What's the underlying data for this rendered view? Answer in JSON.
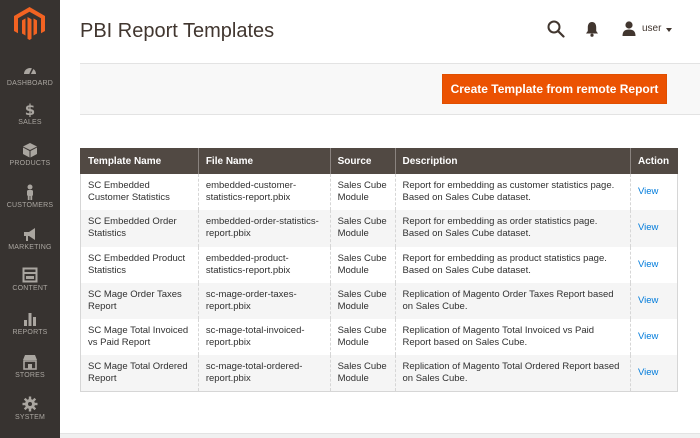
{
  "sidebar": {
    "items": [
      {
        "label": "DASHBOARD",
        "icon": "dashboard-icon"
      },
      {
        "label": "SALES",
        "icon": "dollar-icon"
      },
      {
        "label": "PRODUCTS",
        "icon": "box-icon"
      },
      {
        "label": "CUSTOMERS",
        "icon": "person-icon"
      },
      {
        "label": "MARKETING",
        "icon": "megaphone-icon"
      },
      {
        "label": "CONTENT",
        "icon": "layout-icon"
      },
      {
        "label": "REPORTS",
        "icon": "bar-chart-icon"
      },
      {
        "label": "STORES",
        "icon": "storefront-icon"
      },
      {
        "label": "SYSTEM",
        "icon": "gear-icon"
      }
    ]
  },
  "header": {
    "title": "PBI Report Templates",
    "user": "user"
  },
  "actions": {
    "create_label": "Create Template from remote Report"
  },
  "table": {
    "columns": [
      "Template Name",
      "File Name",
      "Source",
      "Description",
      "Action"
    ],
    "rows": [
      {
        "name": "SC Embedded Customer Statistics",
        "file": "embedded-customer-statistics-report.pbix",
        "source": "Sales Cube Module",
        "description": "Report for embedding as customer statistics page. Based on Sales Cube dataset.",
        "action": "View"
      },
      {
        "name": "SC Embedded Order Statistics",
        "file": "embedded-order-statistics-report.pbix",
        "source": "Sales Cube Module",
        "description": "Report for embedding as order statistics page. Based on Sales Cube dataset.",
        "action": "View"
      },
      {
        "name": "SC Embedded Product Statistics",
        "file": "embedded-product-statistics-report.pbix",
        "source": "Sales Cube Module",
        "description": "Report for embedding as product statistics page. Based on Sales Cube dataset.",
        "action": "View"
      },
      {
        "name": "SC Mage Order Taxes Report",
        "file": "sc-mage-order-taxes-report.pbix",
        "source": "Sales Cube Module",
        "description": "Replication of Magento Order Taxes Report based on Sales Cube.",
        "action": "View"
      },
      {
        "name": "SC Mage Total Invoiced vs Paid Report",
        "file": "sc-mage-total-invoiced-report.pbix",
        "source": "Sales Cube Module",
        "description": "Replication of Magento Total Invoiced vs Paid Report based on Sales Cube.",
        "action": "View"
      },
      {
        "name": "SC Mage Total Ordered Report",
        "file": "sc-mage-total-ordered-report.pbix",
        "source": "Sales Cube Module",
        "description": "Replication of Magento Total Ordered Report based on Sales Cube.",
        "action": "View"
      }
    ]
  },
  "colors": {
    "sidebar_bg": "#373330",
    "accent": "#eb5202",
    "table_header": "#514943",
    "link": "#007bdb"
  }
}
